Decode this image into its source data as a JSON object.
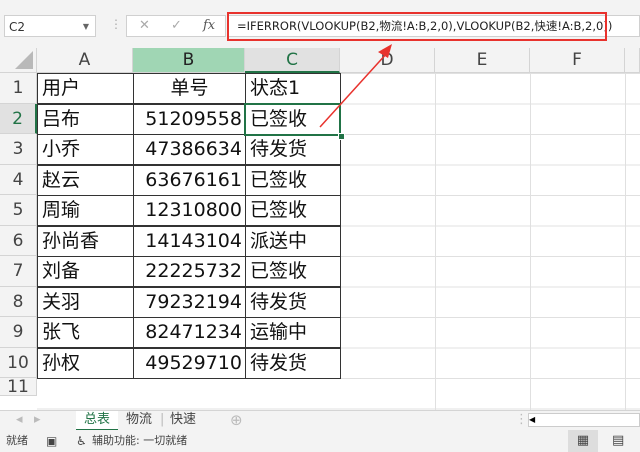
{
  "name_box": "C2",
  "formula": "=IFERROR(VLOOKUP(B2,物流!A:B,2,0),VLOOKUP(B2,快速!A:B,2,0))",
  "icons": {
    "cancel": "✕",
    "enter": "✓",
    "fx": "fx"
  },
  "columns": [
    "A",
    "B",
    "C",
    "D",
    "E",
    "F"
  ],
  "rows": [
    "1",
    "2",
    "3",
    "4",
    "5",
    "6",
    "7",
    "8",
    "9",
    "10",
    "11"
  ],
  "headers": [
    "用户",
    "单号",
    "状态1"
  ],
  "data": [
    [
      "吕布",
      "51209558",
      "已签收"
    ],
    [
      "小乔",
      "47386634",
      "待发货"
    ],
    [
      "赵云",
      "63676161",
      "已签收"
    ],
    [
      "周瑜",
      "12310800",
      "已签收"
    ],
    [
      "孙尚香",
      "14143104",
      "派送中"
    ],
    [
      "刘备",
      "22225732",
      "已签收"
    ],
    [
      "关羽",
      "79232194",
      "待发货"
    ],
    [
      "张飞",
      "82471234",
      "运输中"
    ],
    [
      "孙权",
      "49529710",
      "待发货"
    ]
  ],
  "sheets": [
    "总表",
    "物流",
    "快速"
  ],
  "status": {
    "ready": "就绪",
    "accessibility": "辅助功能: 一切就绪"
  },
  "colors": {
    "accent": "#217346",
    "annotation": "#e8322d"
  }
}
